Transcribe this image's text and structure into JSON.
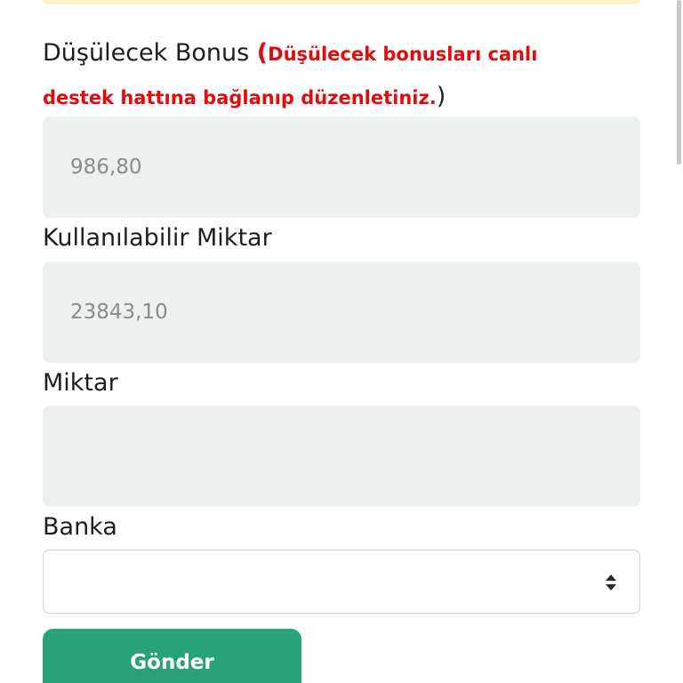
{
  "form": {
    "bonus_label": "Düşülecek Bonus",
    "bonus_open_paren": "(",
    "bonus_warning": "Düşülecek bonusları canlı destek hattına bağlanıp düzenletiniz.",
    "bonus_close_paren": ")",
    "bonus_value": "986,80",
    "available_label": "Kullanılabilir Miktar",
    "available_value": "23843,10",
    "amount_label": "Miktar",
    "amount_value": "",
    "bank_label": "Banka",
    "bank_selected": "",
    "submit_label": "Gönder"
  },
  "colors": {
    "warning": "#e30b0b",
    "submit_bg": "#27a27a",
    "field_bg": "#edf1ee",
    "banner_bg": "#fbf1c6"
  },
  "icons": {
    "select_arrows": "sort-arrows-icon"
  }
}
